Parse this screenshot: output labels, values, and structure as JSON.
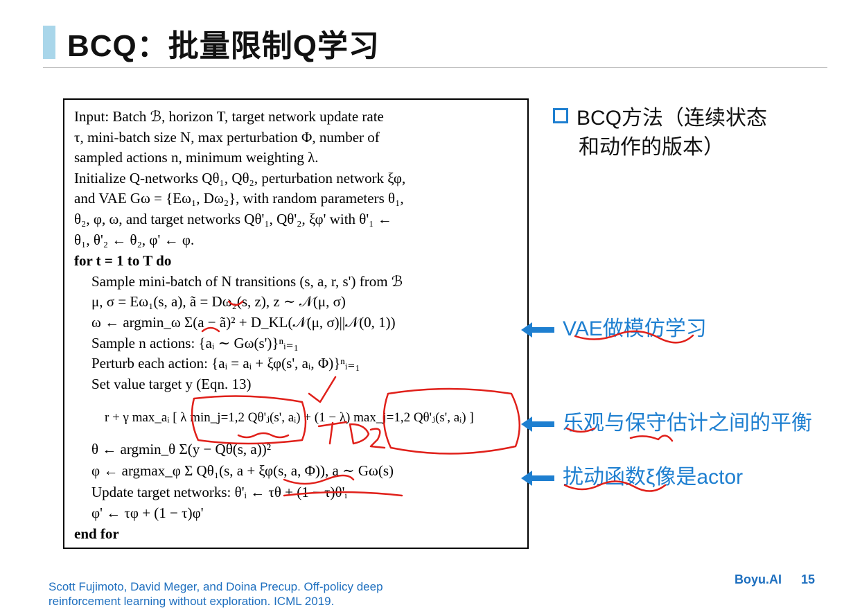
{
  "title": "BCQ：批量限制Q学习",
  "algorithm": {
    "lines": [
      "Input: Batch ℬ, horizon T, target network update rate",
      "τ, mini-batch size N, max perturbation Φ, number of",
      "sampled actions n, minimum weighting λ.",
      "Initialize Q-networks Qθ₁, Qθ₂, perturbation network ξφ,",
      "and VAE Gω = {Eω₁, Dω₂}, with random parameters θ₁,",
      "θ₂, φ, ω, and target networks Qθ'₁, Qθ'₂, ξφ' with θ'₁ ←",
      "θ₁, θ'₂ ← θ₂, φ' ← φ.",
      "for t = 1 to T do",
      "Sample mini-batch of N transitions (s, a, r, s') from ℬ",
      "μ, σ = Eω₁(s, a),    ã = Dω₂(s, z),    z ∼ 𝒩(μ, σ)",
      "ω ← argmin_ω Σ(a − ã)² + D_KL(𝒩(μ, σ)||𝒩(0, 1))",
      "Sample n actions: {aᵢ ∼ Gω(s')}ⁿᵢ₌₁",
      "Perturb each action: {aᵢ = aᵢ + ξφ(s', aᵢ, Φ)}ⁿᵢ₌₁",
      "Set value target y (Eqn. 13)",
      "r + γ max_aᵢ [ λ min_j=1,2 Qθ'ⱼ(s', aᵢ) + (1 − λ) max_j=1,2 Qθ'ⱼ(s', aᵢ) ]",
      "θ ← argmin_θ Σ(y − Qθ(s, a))²",
      "φ ← argmax_φ Σ Qθ₁(s, a + ξφ(s, a, Φ)), a ∼ Gω(s)",
      "Update target networks: θ'ᵢ ← τθ + (1 − τ)θ'ᵢ",
      "φ' ← τφ + (1 − τ)φ'",
      "end for"
    ]
  },
  "bullet": {
    "line1": "BCQ方法（连续状态",
    "line2": "和动作的版本）"
  },
  "annotations": [
    "VAE做模仿学习",
    "乐观与保守估计之间的平衡",
    "扰动函数ξ像是actor"
  ],
  "citation": {
    "line1": "Scott Fujimoto, David Meger, and Doina Precup. Off-policy deep",
    "line2": "reinforcement learning without exploration. ICML 2019."
  },
  "brand": "Boyu.AI",
  "page_number": "15",
  "colors": {
    "accent": "#1e7fd0",
    "title_bar": "#a9d6ea",
    "handwriting": "#e0201a"
  }
}
